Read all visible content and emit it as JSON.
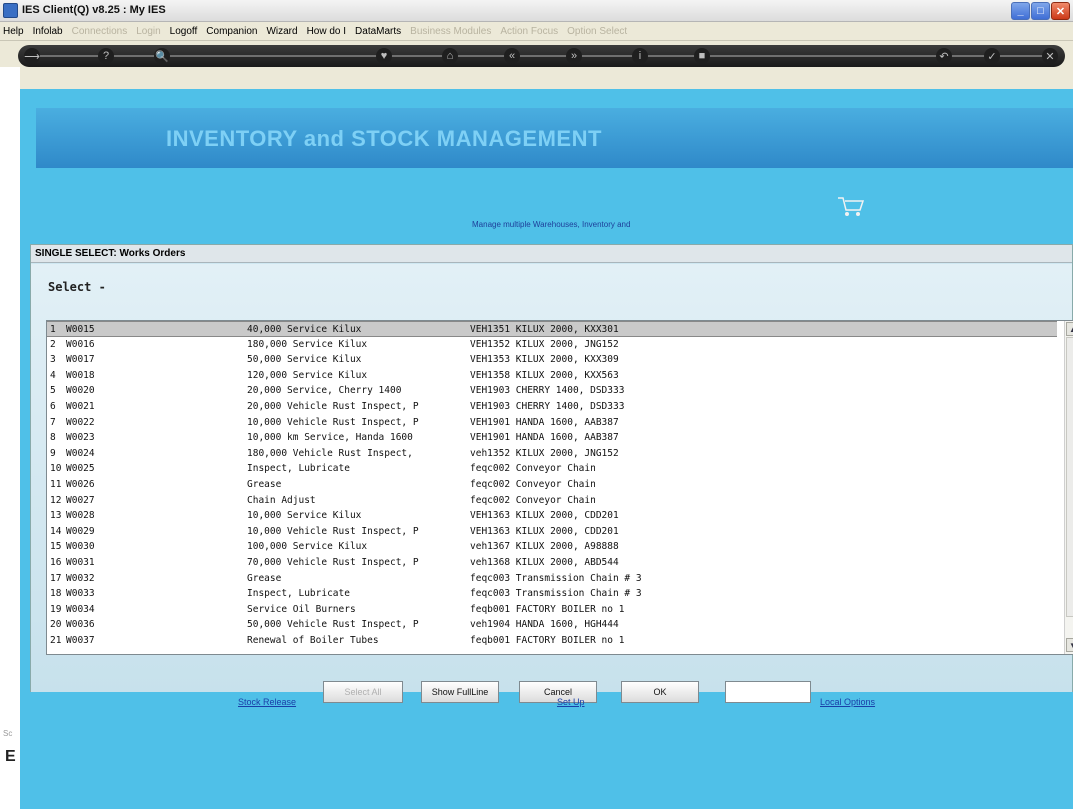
{
  "window": {
    "title": "IES Client(Q) v8.25 : My IES",
    "buttons": [
      "_",
      "□",
      "✕"
    ]
  },
  "menubar": {
    "items": [
      {
        "label": "Help",
        "disabled": false
      },
      {
        "label": "Infolab",
        "disabled": false
      },
      {
        "label": "Connections",
        "disabled": true
      },
      {
        "label": "Login",
        "disabled": true
      },
      {
        "label": "Logoff",
        "disabled": false
      },
      {
        "label": "Companion",
        "disabled": false
      },
      {
        "label": "Wizard",
        "disabled": false
      },
      {
        "label": "How do I",
        "disabled": false
      },
      {
        "label": "DataMarts",
        "disabled": false
      },
      {
        "label": "Business Modules",
        "disabled": true
      },
      {
        "label": "Action Focus",
        "disabled": true
      },
      {
        "label": "Option Select",
        "disabled": true
      }
    ]
  },
  "toolbar": {
    "icons": [
      "arrow-icon",
      "help-icon",
      "search-icon",
      "heart-icon",
      "home-icon",
      "back-icon",
      "forward-icon",
      "info-icon",
      "stop-icon",
      "undo-icon",
      "check-icon",
      "close-icon"
    ],
    "glyphs": [
      "⟶",
      "?",
      "🔍",
      "♥",
      "⌂",
      "«",
      "»",
      "i",
      "■",
      "↶",
      "✓",
      "✕"
    ]
  },
  "banner": {
    "title": "INVENTORY and STOCK MANAGEMENT",
    "subtitle": "Manage multiple Warehouses, Inventory and"
  },
  "dialog": {
    "header": "SINGLE SELECT: Works Orders",
    "select_label": "Select -",
    "rows": [
      {
        "num": "1",
        "code": "W0015",
        "desc": "40,000 Service Kilux",
        "ref": "VEH1351 KILUX 2000, KXX301"
      },
      {
        "num": "2",
        "code": "W0016",
        "desc": "180,000 Service Kilux",
        "ref": "VEH1352 KILUX 2000, JNG152"
      },
      {
        "num": "3",
        "code": "W0017",
        "desc": "50,000 Service Kilux",
        "ref": "VEH1353 KILUX 2000, KXX309"
      },
      {
        "num": "4",
        "code": "W0018",
        "desc": "120,000 Service Kilux",
        "ref": "VEH1358 KILUX 2000, KXX563"
      },
      {
        "num": "5",
        "code": "W0020",
        "desc": "20,000 Service, Cherry 1400",
        "ref": "VEH1903 CHERRY 1400, DSD333"
      },
      {
        "num": "6",
        "code": "W0021",
        "desc": "20,000 Vehicle Rust Inspect, P",
        "ref": "VEH1903 CHERRY 1400, DSD333"
      },
      {
        "num": "7",
        "code": "W0022",
        "desc": "10,000 Vehicle Rust Inspect, P",
        "ref": "VEH1901 HANDA 1600, AAB387"
      },
      {
        "num": "8",
        "code": "W0023",
        "desc": "10,000 km Service, Handa 1600",
        "ref": "VEH1901 HANDA 1600, AAB387"
      },
      {
        "num": "9",
        "code": "W0024",
        "desc": "180,000 Vehicle Rust Inspect,",
        "ref": "veh1352 KILUX 2000, JNG152"
      },
      {
        "num": "10",
        "code": "W0025",
        "desc": "Inspect, Lubricate",
        "ref": "feqc002 Conveyor Chain"
      },
      {
        "num": "11",
        "code": "W0026",
        "desc": "Grease",
        "ref": "feqc002 Conveyor Chain"
      },
      {
        "num": "12",
        "code": "W0027",
        "desc": "Chain Adjust",
        "ref": "feqc002 Conveyor Chain"
      },
      {
        "num": "13",
        "code": "W0028",
        "desc": "10,000 Service Kilux",
        "ref": "VEH1363 KILUX 2000, CDD201"
      },
      {
        "num": "14",
        "code": "W0029",
        "desc": "10,000 Vehicle Rust Inspect, P",
        "ref": "VEH1363 KILUX 2000, CDD201"
      },
      {
        "num": "15",
        "code": "W0030",
        "desc": "100,000 Service Kilux",
        "ref": "veh1367 KILUX 2000, A98888"
      },
      {
        "num": "16",
        "code": "W0031",
        "desc": "70,000 Vehicle Rust Inspect, P",
        "ref": "veh1368 KILUX 2000, ABD544"
      },
      {
        "num": "17",
        "code": "W0032",
        "desc": "Grease",
        "ref": "feqc003 Transmission Chain # 3"
      },
      {
        "num": "18",
        "code": "W0033",
        "desc": "Inspect, Lubricate",
        "ref": "feqc003 Transmission Chain # 3"
      },
      {
        "num": "19",
        "code": "W0034",
        "desc": "Service Oil Burners",
        "ref": "feqb001 FACTORY BOILER no 1"
      },
      {
        "num": "20",
        "code": "W0036",
        "desc": "50,000 Vehicle Rust Inspect, P",
        "ref": "veh1904 HANDA 1600, HGH444"
      },
      {
        "num": "21",
        "code": "W0037",
        "desc": "Renewal of Boiler Tubes",
        "ref": "feqb001 FACTORY BOILER no 1"
      }
    ],
    "buttons": {
      "disabled_label": "Select All",
      "show_full_line": "Show FullLine",
      "cancel": "Cancel",
      "ok": "OK"
    },
    "input_value": ""
  },
  "links": {
    "stock_release": "Stock Release",
    "set_up": "Set Up",
    "local_options": "Local Options"
  },
  "left_letter": "E",
  "left_mark": "Sc"
}
